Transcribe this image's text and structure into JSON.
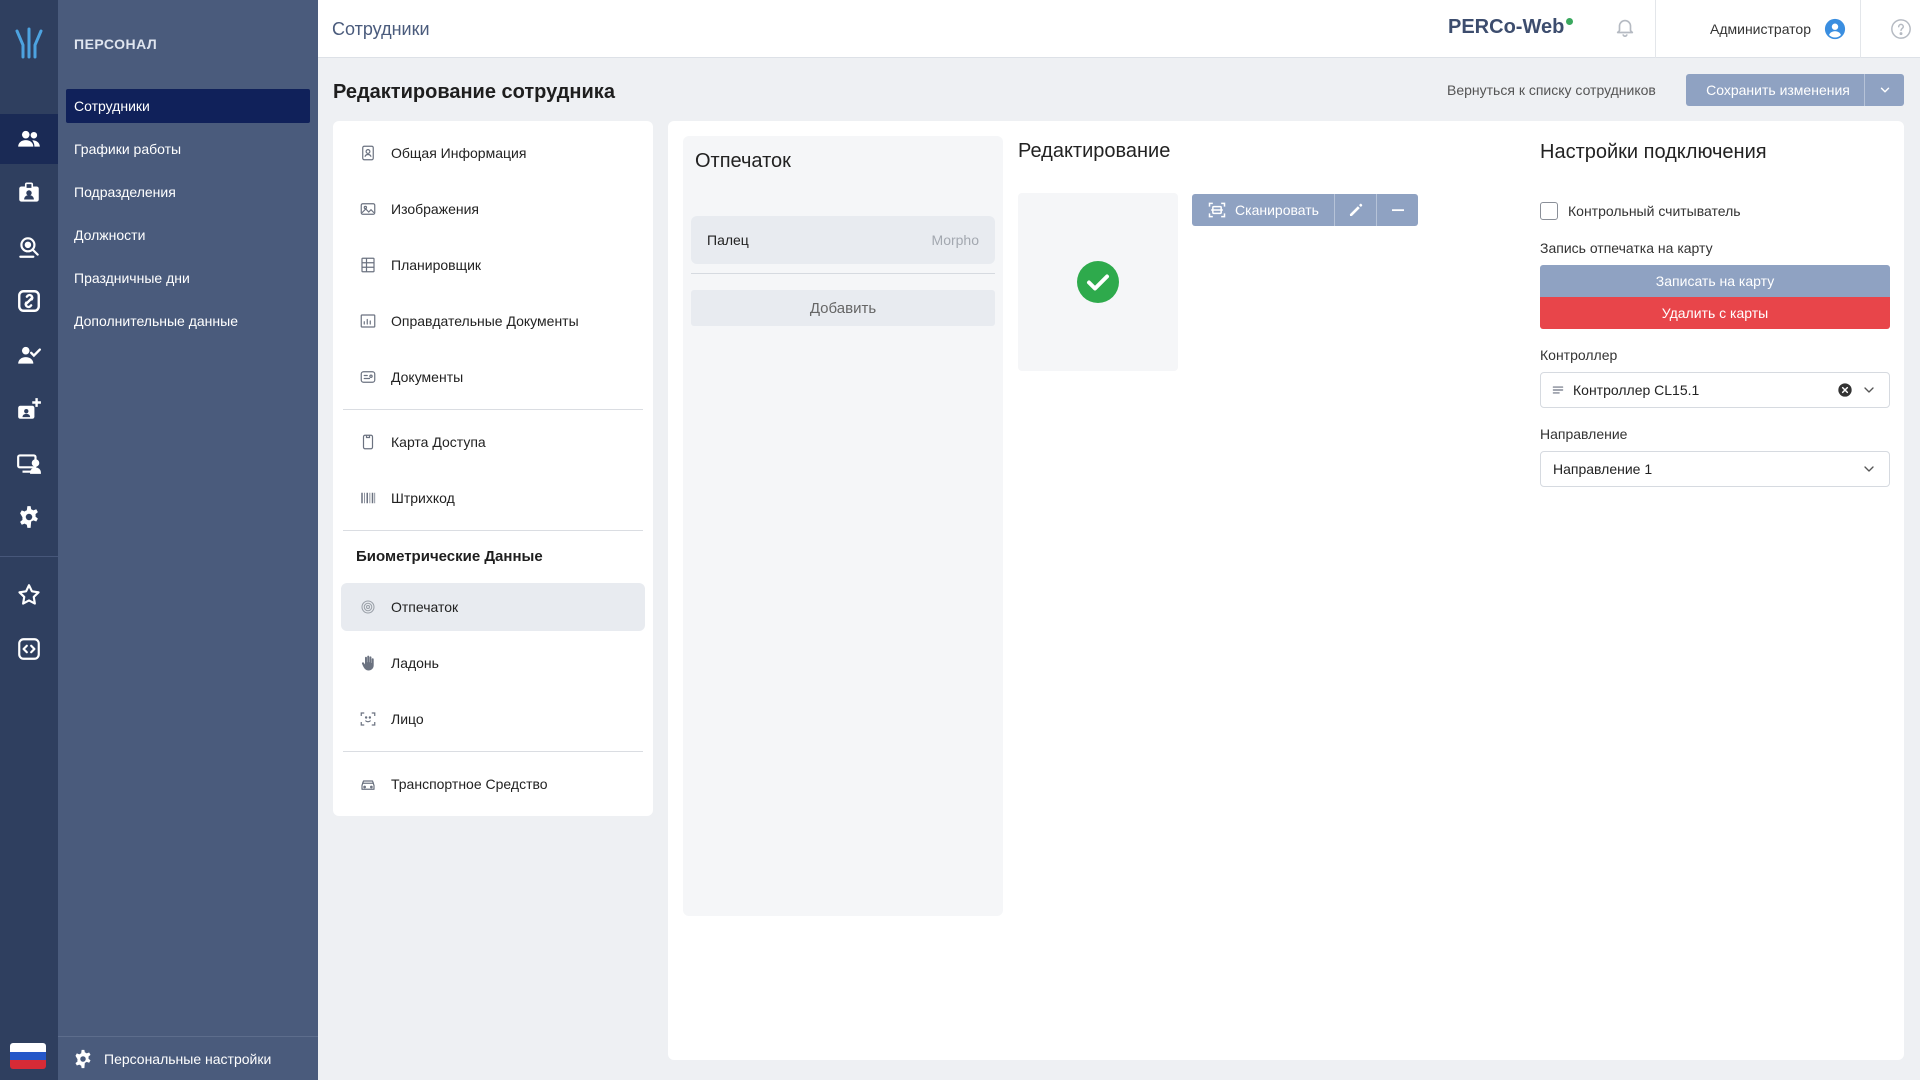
{
  "rail": {
    "items": [
      {
        "name": "users-icon",
        "active": true
      },
      {
        "name": "badge-icon"
      },
      {
        "name": "location-search-icon"
      },
      {
        "name": "link-icon"
      },
      {
        "name": "user-check-icon"
      },
      {
        "name": "add-badge-icon"
      },
      {
        "name": "monitor-user-icon"
      },
      {
        "name": "gear-icon"
      },
      {
        "name": "star-icon"
      },
      {
        "name": "code-icon"
      }
    ]
  },
  "sidebar": {
    "section_title": "ПЕРСОНАЛ",
    "items": [
      {
        "label": "Сотрудники",
        "active": true
      },
      {
        "label": "Графики работы"
      },
      {
        "label": "Подразделения"
      },
      {
        "label": "Должности"
      },
      {
        "label": "Праздничные дни"
      },
      {
        "label": "Дополнительные данные"
      }
    ],
    "personal_settings": "Персональные настройки"
  },
  "header": {
    "title": "Сотрудники",
    "brand": "PERCo-Web",
    "user": "Администратор"
  },
  "subheader": {
    "title": "Редактирование сотрудника",
    "back_link": "Вернуться к списку сотрудников",
    "save_label": "Сохранить изменения"
  },
  "nav": {
    "items": [
      {
        "label": "Общая Информация",
        "icon": "id-card-icon"
      },
      {
        "label": "Изображения",
        "icon": "image-icon"
      },
      {
        "label": "Планировщик",
        "icon": "calendar-grid-icon"
      },
      {
        "label": "Оправдательные Документы",
        "icon": "chart-document-icon"
      },
      {
        "label": "Документы",
        "icon": "document-icon"
      },
      {
        "label": "Карта Доступа",
        "icon": "card-icon"
      },
      {
        "label": "Штрихкод",
        "icon": "barcode-icon"
      }
    ],
    "bio_heading": "Биометрические Данные",
    "bio_items": [
      {
        "label": "Отпечаток",
        "icon": "fingerprint-icon",
        "active": true
      },
      {
        "label": "Ладонь",
        "icon": "palm-icon"
      },
      {
        "label": "Лицо",
        "icon": "face-scan-icon"
      }
    ],
    "vehicle": {
      "label": "Транспортное Средство",
      "icon": "car-icon"
    }
  },
  "fingerprint": {
    "title": "Отпечаток",
    "finger_label": "Палец",
    "device": "Morpho",
    "add_label": "Добавить"
  },
  "editing": {
    "title": "Редактирование",
    "scan_label": "Сканировать",
    "status_color": "#2eaa4c"
  },
  "connection": {
    "title": "Настройки подключения",
    "control_reader": "Контрольный считыватель",
    "control_reader_checked": false,
    "write_section": "Запись отпечатка на карту",
    "write_btn": "Записать на карту",
    "delete_btn": "Удалить с карты",
    "controller_label": "Контроллер",
    "controller_value": "Контроллер CL15.1",
    "direction_label": "Направление",
    "direction_value": "Направление 1"
  },
  "colors": {
    "rail": "#2f3f5f",
    "sidebar": "#4a5b7c",
    "active": "#10215a",
    "accent_button": "#8fa2c2",
    "danger": "#e8454a",
    "success": "#2eaa4c"
  }
}
